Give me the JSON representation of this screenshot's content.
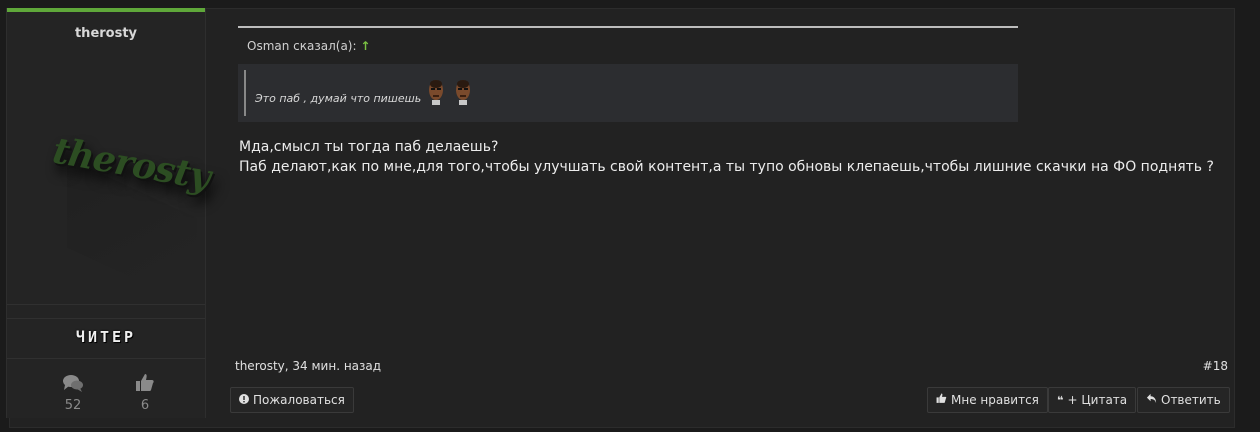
{
  "user": {
    "name": "therosty",
    "avatar_text": "therosty",
    "rank": "ЧИТЕР",
    "stats": [
      {
        "icon": "comments-icon",
        "value": "52"
      },
      {
        "icon": "thumbs-up-icon",
        "value": "6"
      }
    ]
  },
  "quote": {
    "author": "Osman сказал(а):",
    "arrow": "↑",
    "text": "Это паб , думай что пишешь"
  },
  "message": {
    "line1": "Мда,смысл ты тогда паб делаешь?",
    "line2": "Паб делают,как по мне,для того,чтобы улучшать свой контент,а ты тупо обновы клепаешь,чтобы лишние скачки на ФО поднять ?"
  },
  "meta": {
    "author": "therosty",
    "time": "34 мин. назад",
    "post_number": "#18"
  },
  "actions": {
    "report": "Пожаловаться",
    "like": "Мне нравится",
    "quote": "+ Цитата",
    "reply": "Ответить"
  },
  "colors": {
    "accent": "#5fa83a",
    "arrow": "#7ac142"
  }
}
